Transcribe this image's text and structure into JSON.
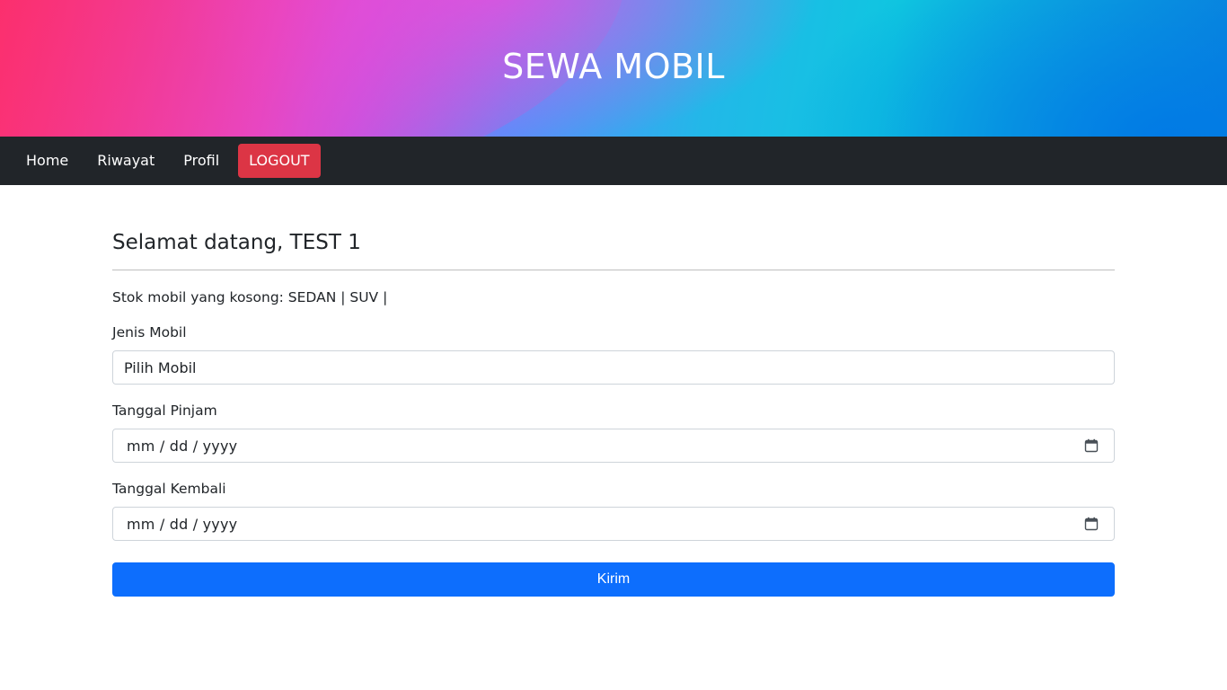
{
  "header": {
    "title": "SEWA MOBIL"
  },
  "nav": {
    "items": [
      {
        "label": "Home"
      },
      {
        "label": "Riwayat"
      },
      {
        "label": "Profil"
      }
    ],
    "logout_label": "LOGOUT",
    "logout_color": "#dc3545"
  },
  "main": {
    "welcome": "Selamat datang, TEST 1",
    "stock_text": "Stok mobil yang kosong: SEDAN | SUV |",
    "form": {
      "car_type": {
        "label": "Jenis Mobil",
        "value": "Pilih Mobil"
      },
      "borrow_date": {
        "label": "Tanggal Pinjam",
        "placeholder": "mm / dd / yyyy",
        "icon": "calendar-icon"
      },
      "return_date": {
        "label": "Tanggal Kembali",
        "placeholder": "mm / dd / yyyy",
        "icon": "calendar-icon"
      },
      "submit_label": "Kirim",
      "submit_color": "#0d6efd"
    }
  }
}
